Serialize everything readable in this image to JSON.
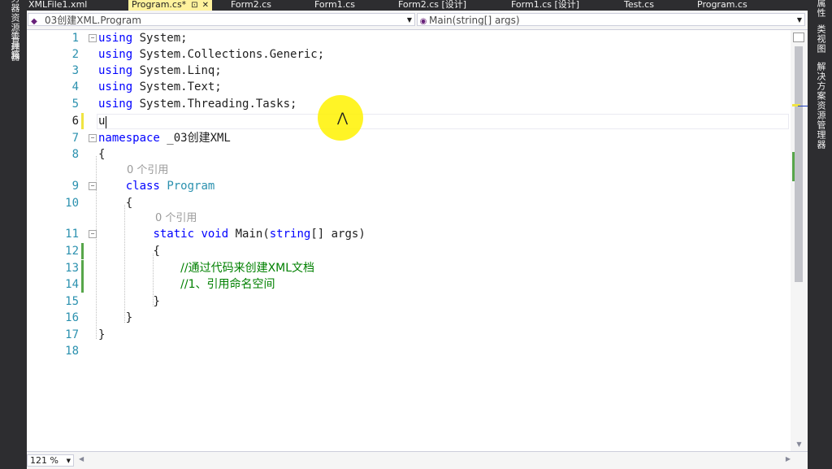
{
  "left_panel": {
    "tabs": [
      "服务器资源管理器",
      "工具箱"
    ]
  },
  "right_panel": {
    "tabs": [
      "属性",
      "类视图",
      "解决方案资源管理器"
    ]
  },
  "tabs": [
    {
      "label": "XMLFile1.xml",
      "active": false
    },
    {
      "label": "Program.cs*",
      "active": true
    },
    {
      "label": "Form2.cs",
      "active": false
    },
    {
      "label": "Form1.cs",
      "active": false
    },
    {
      "label": "Form2.cs [设计]",
      "active": false
    },
    {
      "label": "Form1.cs [设计]",
      "active": false
    },
    {
      "label": "Test.cs",
      "active": false
    },
    {
      "label": "Program.cs",
      "active": false
    }
  ],
  "tab_icons": {
    "pin": "⊡",
    "close": "✕"
  },
  "navigation": {
    "class_selector": "_03创建XML.Program",
    "member_selector": "Main(string[] args)"
  },
  "editor": {
    "line_numbers": [
      "1",
      "2",
      "3",
      "4",
      "5",
      "6",
      "7",
      "8",
      "9",
      "10",
      "11",
      "12",
      "13",
      "14",
      "15",
      "16",
      "17",
      "18"
    ],
    "code_lens": {
      "references_label": "0 个引用"
    },
    "lines": {
      "l1": {
        "kw": "using",
        "rest": " System;"
      },
      "l2": {
        "kw": "using",
        "rest": " System.Collections.Generic;"
      },
      "l3": {
        "kw": "using",
        "rest": " System.Linq;"
      },
      "l4": {
        "kw": "using",
        "rest": " System.Text;"
      },
      "l5": {
        "kw": "using",
        "rest": " System.Threading.Tasks;"
      },
      "l6": {
        "text": "u"
      },
      "l7": {
        "kw": "namespace",
        "rest": " _03创建XML"
      },
      "l8": {
        "text": "{"
      },
      "l9": {
        "kw": "class",
        "type": "Program"
      },
      "l10": {
        "text": "{"
      },
      "l11": {
        "kw1": "static",
        "kw2": "void",
        "name": " Main(",
        "kw3": "string",
        "rest": "[] args)"
      },
      "l12": {
        "text": "{"
      },
      "l13": {
        "comment": "//通过代码来创建XML文档"
      },
      "l14": {
        "comment": "//1、引用命名空间"
      },
      "l15": {
        "text": "}"
      },
      "l16": {
        "text": "}"
      },
      "l17": {
        "text": "}"
      }
    },
    "fold_glyph": "−"
  },
  "zoom": {
    "level": "121 %"
  },
  "colors": {
    "keyword": "#0000ff",
    "type": "#2b91af",
    "comment": "#008000",
    "line_number": "#2b91af",
    "active_tab": "#fff29d",
    "cursor_highlight": "#fff200"
  }
}
